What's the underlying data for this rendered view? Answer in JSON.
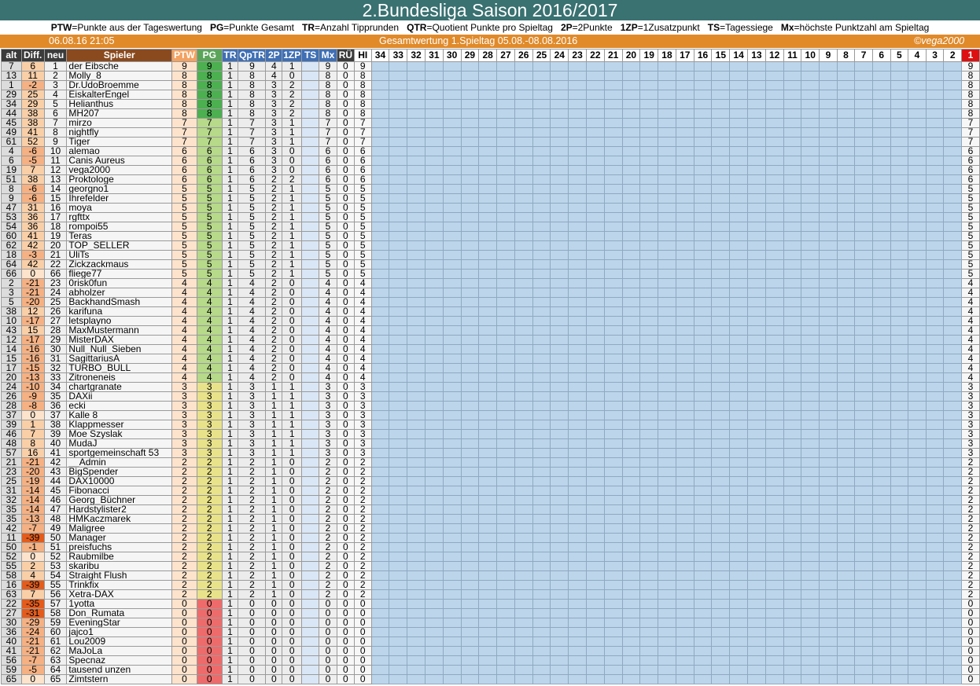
{
  "title": "2.Bundesliga Saison 2016/2017",
  "legend": [
    {
      "abbr": "PTW",
      "text": "=Punkte aus der Tageswertung"
    },
    {
      "abbr": "PG",
      "text": "=Punkte Gesamt"
    },
    {
      "abbr": "TR",
      "text": "=Anzahl Tipprunden"
    },
    {
      "abbr": "QTR",
      "text": "=Quotient Punkte pro Spieltag"
    },
    {
      "abbr": "2P",
      "text": "=2Punkte"
    },
    {
      "abbr": "1ZP",
      "text": "=1Zusatzpunkt"
    },
    {
      "abbr": "TS",
      "text": "=Tagessiege"
    },
    {
      "abbr": "Mx",
      "text": "=höchste Punktzahl am Spieltag"
    }
  ],
  "info": {
    "datetime": "06.08.16 21:05",
    "heading": "Gesamtwertung 1.Spieltag 05.08.-08.08.2016",
    "credit": "©vega2000"
  },
  "headers": [
    "alt",
    "Diff.",
    "neu",
    "Spieler",
    "PTW",
    "PG",
    "TR",
    "QpTR",
    "2P",
    "1ZP",
    "TS",
    "Mx",
    "RÜ",
    "HI"
  ],
  "days": [
    "34",
    "33",
    "32",
    "31",
    "30",
    "29",
    "28",
    "27",
    "26",
    "25",
    "24",
    "23",
    "22",
    "21",
    "20",
    "19",
    "18",
    "17",
    "16",
    "15",
    "14",
    "13",
    "12",
    "11",
    "10",
    "9",
    "8",
    "7",
    "6",
    "5",
    "4",
    "3",
    "2",
    "1"
  ],
  "colors": {
    "pg_high": "#4caf50",
    "pg_mid": "#b6d98a",
    "pg_low": "#e8e28a",
    "pg_zero": "#ee6b6b"
  },
  "rows": [
    [
      "7",
      "6",
      "1",
      "der Eibsche",
      "9",
      "9",
      "1",
      "9",
      "4",
      "1",
      "",
      "9",
      "0",
      "9"
    ],
    [
      "13",
      "11",
      "2",
      "Molly_8",
      "8",
      "8",
      "1",
      "8",
      "4",
      "0",
      "",
      "8",
      "0",
      "8"
    ],
    [
      "1",
      "-2",
      "3",
      "Dr.UdoBroemme",
      "8",
      "8",
      "1",
      "8",
      "3",
      "2",
      "",
      "8",
      "0",
      "8"
    ],
    [
      "29",
      "25",
      "4",
      "EiskalterEngel",
      "8",
      "8",
      "1",
      "8",
      "3",
      "2",
      "",
      "8",
      "0",
      "8"
    ],
    [
      "34",
      "29",
      "5",
      "Helianthus",
      "8",
      "8",
      "1",
      "8",
      "3",
      "2",
      "",
      "8",
      "0",
      "8"
    ],
    [
      "44",
      "38",
      "6",
      "MH207",
      "8",
      "8",
      "1",
      "8",
      "3",
      "2",
      "",
      "8",
      "0",
      "8"
    ],
    [
      "45",
      "38",
      "7",
      "mirzo",
      "7",
      "7",
      "1",
      "7",
      "3",
      "1",
      "",
      "7",
      "0",
      "7"
    ],
    [
      "49",
      "41",
      "8",
      "nightfly",
      "7",
      "7",
      "1",
      "7",
      "3",
      "1",
      "",
      "7",
      "0",
      "7"
    ],
    [
      "61",
      "52",
      "9",
      "Tiger",
      "7",
      "7",
      "1",
      "7",
      "3",
      "1",
      "",
      "7",
      "0",
      "7"
    ],
    [
      "4",
      "-6",
      "10",
      "alemao",
      "6",
      "6",
      "1",
      "6",
      "3",
      "0",
      "",
      "6",
      "0",
      "6"
    ],
    [
      "6",
      "-5",
      "11",
      "Canis Aureus",
      "6",
      "6",
      "1",
      "6",
      "3",
      "0",
      "",
      "6",
      "0",
      "6"
    ],
    [
      "19",
      "7",
      "12",
      "vega2000",
      "6",
      "6",
      "1",
      "6",
      "3",
      "0",
      "",
      "6",
      "0",
      "6"
    ],
    [
      "51",
      "38",
      "13",
      "Proktologe",
      "6",
      "6",
      "1",
      "6",
      "2",
      "2",
      "",
      "6",
      "0",
      "6"
    ],
    [
      "8",
      "-6",
      "14",
      "georgno1",
      "5",
      "5",
      "1",
      "5",
      "2",
      "1",
      "",
      "5",
      "0",
      "5"
    ],
    [
      "9",
      "-6",
      "15",
      "Ihrefelder",
      "5",
      "5",
      "1",
      "5",
      "2",
      "1",
      "",
      "5",
      "0",
      "5"
    ],
    [
      "47",
      "31",
      "16",
      "moya",
      "5",
      "5",
      "1",
      "5",
      "2",
      "1",
      "",
      "5",
      "0",
      "5"
    ],
    [
      "53",
      "36",
      "17",
      "rgfttx",
      "5",
      "5",
      "1",
      "5",
      "2",
      "1",
      "",
      "5",
      "0",
      "5"
    ],
    [
      "54",
      "36",
      "18",
      "rompoi55",
      "5",
      "5",
      "1",
      "5",
      "2",
      "1",
      "",
      "5",
      "0",
      "5"
    ],
    [
      "60",
      "41",
      "19",
      "Teras",
      "5",
      "5",
      "1",
      "5",
      "2",
      "1",
      "",
      "5",
      "0",
      "5"
    ],
    [
      "62",
      "42",
      "20",
      "TOP_SELLER",
      "5",
      "5",
      "1",
      "5",
      "2",
      "1",
      "",
      "5",
      "0",
      "5"
    ],
    [
      "18",
      "-3",
      "21",
      "UliTs",
      "5",
      "5",
      "1",
      "5",
      "2",
      "1",
      "",
      "5",
      "0",
      "5"
    ],
    [
      "64",
      "42",
      "22",
      "Zickzackmaus",
      "5",
      "5",
      "1",
      "5",
      "2",
      "1",
      "",
      "5",
      "0",
      "5"
    ],
    [
      "66",
      "0",
      "66",
      "fliege77",
      "5",
      "5",
      "1",
      "5",
      "2",
      "1",
      "",
      "5",
      "0",
      "5"
    ],
    [
      "2",
      "-21",
      "23",
      "0risk0fun",
      "4",
      "4",
      "1",
      "4",
      "2",
      "0",
      "",
      "4",
      "0",
      "4"
    ],
    [
      "3",
      "-21",
      "24",
      "abholzer",
      "4",
      "4",
      "1",
      "4",
      "2",
      "0",
      "",
      "4",
      "0",
      "4"
    ],
    [
      "5",
      "-20",
      "25",
      "BackhandSmash",
      "4",
      "4",
      "1",
      "4",
      "2",
      "0",
      "",
      "4",
      "0",
      "4"
    ],
    [
      "38",
      "12",
      "26",
      "karifuna",
      "4",
      "4",
      "1",
      "4",
      "2",
      "0",
      "",
      "4",
      "0",
      "4"
    ],
    [
      "10",
      "-17",
      "27",
      "letsplayno",
      "4",
      "4",
      "1",
      "4",
      "2",
      "0",
      "",
      "4",
      "0",
      "4"
    ],
    [
      "43",
      "15",
      "28",
      "MaxMustermann",
      "4",
      "4",
      "1",
      "4",
      "2",
      "0",
      "",
      "4",
      "0",
      "4"
    ],
    [
      "12",
      "-17",
      "29",
      "MisterDAX",
      "4",
      "4",
      "1",
      "4",
      "2",
      "0",
      "",
      "4",
      "0",
      "4"
    ],
    [
      "14",
      "-16",
      "30",
      "Null_Null_Sieben",
      "4",
      "4",
      "1",
      "4",
      "2",
      "0",
      "",
      "4",
      "0",
      "4"
    ],
    [
      "15",
      "-16",
      "31",
      "SagittariusA",
      "4",
      "4",
      "1",
      "4",
      "2",
      "0",
      "",
      "4",
      "0",
      "4"
    ],
    [
      "17",
      "-15",
      "32",
      "TURBO_BULL",
      "4",
      "4",
      "1",
      "4",
      "2",
      "0",
      "",
      "4",
      "0",
      "4"
    ],
    [
      "20",
      "-13",
      "33",
      "Zitroneneis",
      "4",
      "4",
      "1",
      "4",
      "2",
      "0",
      "",
      "4",
      "0",
      "4"
    ],
    [
      "24",
      "-10",
      "34",
      "chartgranate",
      "3",
      "3",
      "1",
      "3",
      "1",
      "1",
      "",
      "3",
      "0",
      "3"
    ],
    [
      "26",
      "-9",
      "35",
      "DAXii",
      "3",
      "3",
      "1",
      "3",
      "1",
      "1",
      "",
      "3",
      "0",
      "3"
    ],
    [
      "28",
      "-8",
      "36",
      "ecki",
      "3",
      "3",
      "1",
      "3",
      "1",
      "1",
      "",
      "3",
      "0",
      "3"
    ],
    [
      "37",
      "0",
      "37",
      "Kalle 8",
      "3",
      "3",
      "1",
      "3",
      "1",
      "1",
      "",
      "3",
      "0",
      "3"
    ],
    [
      "39",
      "1",
      "38",
      "Klappmesser",
      "3",
      "3",
      "1",
      "3",
      "1",
      "1",
      "",
      "3",
      "0",
      "3"
    ],
    [
      "46",
      "7",
      "39",
      "Moe Szyslak",
      "3",
      "3",
      "1",
      "3",
      "1",
      "1",
      "",
      "3",
      "0",
      "3"
    ],
    [
      "48",
      "8",
      "40",
      "MudaJ",
      "3",
      "3",
      "1",
      "3",
      "1",
      "1",
      "",
      "3",
      "0",
      "3"
    ],
    [
      "57",
      "16",
      "41",
      "sportgemeinschaft 53",
      "3",
      "3",
      "1",
      "3",
      "1",
      "1",
      "",
      "3",
      "0",
      "3"
    ],
    [
      "21",
      "-21",
      "42",
      "__Admin",
      "2",
      "2",
      "1",
      "2",
      "1",
      "0",
      "",
      "2",
      "0",
      "2"
    ],
    [
      "23",
      "-20",
      "43",
      "BigSpender",
      "2",
      "2",
      "1",
      "2",
      "1",
      "0",
      "",
      "2",
      "0",
      "2"
    ],
    [
      "25",
      "-19",
      "44",
      "DAX10000",
      "2",
      "2",
      "1",
      "2",
      "1",
      "0",
      "",
      "2",
      "0",
      "2"
    ],
    [
      "31",
      "-14",
      "45",
      "Fibonacci",
      "2",
      "2",
      "1",
      "2",
      "1",
      "0",
      "",
      "2",
      "0",
      "2"
    ],
    [
      "32",
      "-14",
      "46",
      "Georg_Büchner",
      "2",
      "2",
      "1",
      "2",
      "1",
      "0",
      "",
      "2",
      "0",
      "2"
    ],
    [
      "35",
      "-14",
      "47",
      "Hardstylister2",
      "2",
      "2",
      "1",
      "2",
      "1",
      "0",
      "",
      "2",
      "0",
      "2"
    ],
    [
      "35",
      "-13",
      "48",
      "HMKaczmarek",
      "2",
      "2",
      "1",
      "2",
      "1",
      "0",
      "",
      "2",
      "0",
      "2"
    ],
    [
      "42",
      "-7",
      "49",
      "Maligree",
      "2",
      "2",
      "1",
      "2",
      "1",
      "0",
      "",
      "2",
      "0",
      "2"
    ],
    [
      "11",
      "-39",
      "50",
      "Manager",
      "2",
      "2",
      "1",
      "2",
      "1",
      "0",
      "",
      "2",
      "0",
      "2"
    ],
    [
      "50",
      "-1",
      "51",
      "preisfuchs",
      "2",
      "2",
      "1",
      "2",
      "1",
      "0",
      "",
      "2",
      "0",
      "2"
    ],
    [
      "52",
      "0",
      "52",
      "Raubmilbe",
      "2",
      "2",
      "1",
      "2",
      "1",
      "0",
      "",
      "2",
      "0",
      "2"
    ],
    [
      "55",
      "2",
      "53",
      "skaribu",
      "2",
      "2",
      "1",
      "2",
      "1",
      "0",
      "",
      "2",
      "0",
      "2"
    ],
    [
      "58",
      "4",
      "54",
      "Straight Flush",
      "2",
      "2",
      "1",
      "2",
      "1",
      "0",
      "",
      "2",
      "0",
      "2"
    ],
    [
      "16",
      "-39",
      "55",
      "Trinkfix",
      "2",
      "2",
      "1",
      "2",
      "1",
      "0",
      "",
      "2",
      "0",
      "2"
    ],
    [
      "63",
      "7",
      "56",
      "Xetra-DAX",
      "2",
      "2",
      "1",
      "2",
      "1",
      "0",
      "",
      "2",
      "0",
      "2"
    ],
    [
      "22",
      "-35",
      "57",
      "1yotta",
      "0",
      "0",
      "1",
      "0",
      "0",
      "0",
      "",
      "0",
      "0",
      "0"
    ],
    [
      "27",
      "-31",
      "58",
      "Don_Rumata",
      "0",
      "0",
      "1",
      "0",
      "0",
      "0",
      "",
      "0",
      "0",
      "0"
    ],
    [
      "30",
      "-29",
      "59",
      "EveningStar",
      "0",
      "0",
      "1",
      "0",
      "0",
      "0",
      "",
      "0",
      "0",
      "0"
    ],
    [
      "36",
      "-24",
      "60",
      "jajco1",
      "0",
      "0",
      "1",
      "0",
      "0",
      "0",
      "",
      "0",
      "0",
      "0"
    ],
    [
      "40",
      "-21",
      "61",
      "Lou2009",
      "0",
      "0",
      "1",
      "0",
      "0",
      "0",
      "",
      "0",
      "0",
      "0"
    ],
    [
      "41",
      "-21",
      "62",
      "MaJoLa",
      "0",
      "0",
      "1",
      "0",
      "0",
      "0",
      "",
      "0",
      "0",
      "0"
    ],
    [
      "56",
      "-7",
      "63",
      "Specnaz",
      "0",
      "0",
      "1",
      "0",
      "0",
      "0",
      "",
      "0",
      "0",
      "0"
    ],
    [
      "59",
      "-5",
      "64",
      "tausend unzen",
      "0",
      "0",
      "1",
      "0",
      "0",
      "0",
      "",
      "0",
      "0",
      "0"
    ],
    [
      "65",
      "0",
      "65",
      "Zimtstern",
      "0",
      "0",
      "1",
      "0",
      "0",
      "0",
      "",
      "0",
      "0",
      "0"
    ]
  ]
}
